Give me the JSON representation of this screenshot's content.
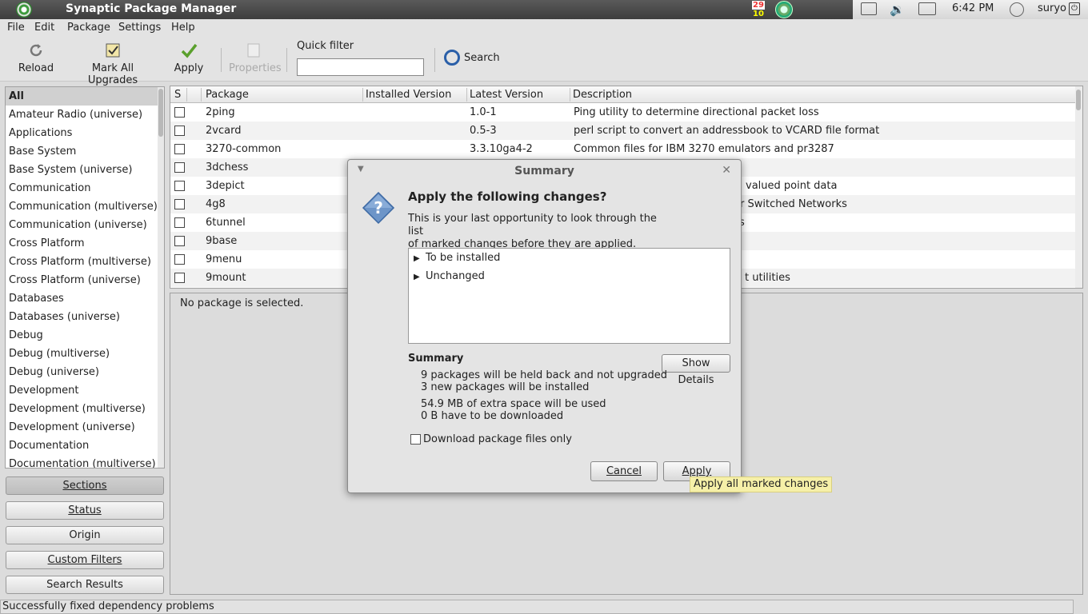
{
  "window": {
    "title": "Synaptic Package Manager"
  },
  "panel": {
    "calendar_day": "29",
    "calendar_month": "10",
    "time": "6:42 PM",
    "user": "suryo"
  },
  "menu": [
    "File",
    "Edit",
    "Package",
    "Settings",
    "Help"
  ],
  "toolbar": {
    "reload": "Reload",
    "mark_all": "Mark All Upgrades",
    "apply": "Apply",
    "properties": "Properties",
    "quick_filter_label": "Quick filter",
    "quick_filter_value": "",
    "search": "Search"
  },
  "sections": [
    "All",
    "Amateur Radio (universe)",
    "Applications",
    "Base System",
    "Base System (universe)",
    "Communication",
    "Communication (multiverse)",
    "Communication (universe)",
    "Cross Platform",
    "Cross Platform (multiverse)",
    "Cross Platform (universe)",
    "Databases",
    "Databases (universe)",
    "Debug",
    "Debug (multiverse)",
    "Debug (universe)",
    "Development",
    "Development (multiverse)",
    "Development (universe)",
    "Documentation",
    "Documentation (multiverse)"
  ],
  "filter_buttons": [
    "Sections",
    "Status",
    "Origin",
    "Custom Filters",
    "Search Results"
  ],
  "table": {
    "headers": [
      "S",
      "Package",
      "Installed Version",
      "Latest Version",
      "Description"
    ],
    "rows": [
      {
        "package": "2ping",
        "installed": "",
        "latest": "1.0-1",
        "description": "Ping utility to determine directional packet loss"
      },
      {
        "package": "2vcard",
        "installed": "",
        "latest": "0.5-3",
        "description": "perl script to convert an addressbook to VCARD file format"
      },
      {
        "package": "3270-common",
        "installed": "",
        "latest": "3.3.10ga4-2",
        "description": "Common files for IBM 3270 emulators and pr3287"
      },
      {
        "package": "3dchess",
        "installed": "",
        "latest": "",
        "description": ""
      },
      {
        "package": "3depict",
        "installed": "",
        "latest": "",
        "description": "valued point data"
      },
      {
        "package": "4g8",
        "installed": "",
        "latest": "",
        "description": "r Switched Networks"
      },
      {
        "package": "6tunnel",
        "installed": "",
        "latest": "",
        "description": "s"
      },
      {
        "package": "9base",
        "installed": "",
        "latest": "",
        "description": ""
      },
      {
        "package": "9menu",
        "installed": "",
        "latest": "",
        "description": ""
      },
      {
        "package": "9mount",
        "installed": "",
        "latest": "",
        "description": "t utilities"
      }
    ]
  },
  "details": {
    "text": "No package is selected."
  },
  "status": {
    "text": "Successfully fixed dependency problems"
  },
  "dialog": {
    "title": "Summary",
    "heading": "Apply the following changes?",
    "message_line1": "This is your last opportunity to look through the list",
    "message_line2": "of marked changes before they are applied.",
    "tree": [
      "To be installed",
      "Unchanged"
    ],
    "summary_heading": "Summary",
    "summary_lines": [
      "9 packages will be held back and not upgraded",
      "3 new packages will be installed",
      "54.9 MB of extra space will be used",
      "0  B have to be downloaded"
    ],
    "show_details": "Show Details",
    "download_only": "Download package files only",
    "download_only_checked": false,
    "cancel": "Cancel",
    "apply": "Apply",
    "tooltip": "Apply all marked changes"
  }
}
